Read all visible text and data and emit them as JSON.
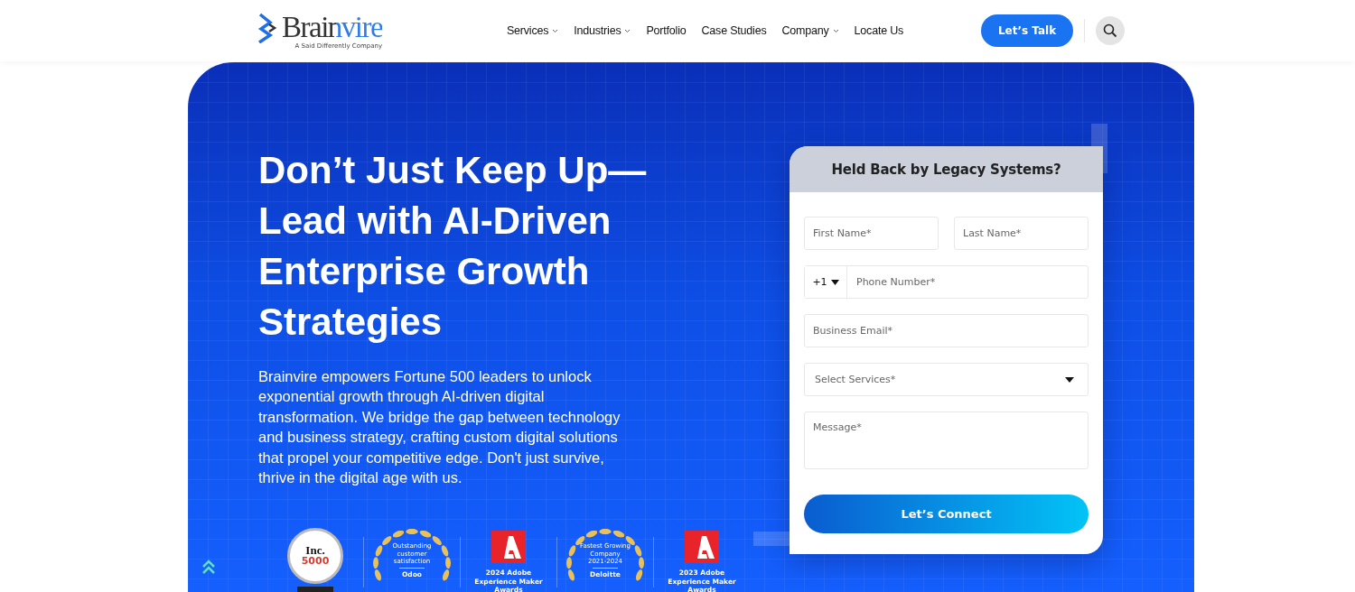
{
  "header": {
    "logo": {
      "name": "Brainvire",
      "tagline": "A Said Differently Company"
    },
    "nav": [
      {
        "label": "Services",
        "dropdown": true
      },
      {
        "label": "Industries",
        "dropdown": true
      },
      {
        "label": "Portfolio",
        "dropdown": false
      },
      {
        "label": "Case Studies",
        "dropdown": false
      },
      {
        "label": "Company",
        "dropdown": true
      },
      {
        "label": "Locate Us",
        "dropdown": false
      }
    ],
    "cta": "Let’s Talk"
  },
  "hero": {
    "heading": "Don’t Just Keep Up—Lead with AI-Driven Enterprise Growth Strategies",
    "description": "Brainvire empowers Fortune 500 leaders to unlock exponential growth through AI-driven digital transformation. We bridge the gap between technology and business strategy, crafting custom digital solutions that propel your competitive edge. Don't just survive, thrive in the digital age with us.",
    "awards": [
      {
        "kind": "trophy",
        "lines": [
          "Inc.",
          "5000"
        ]
      },
      {
        "kind": "laurel",
        "lines": [
          "Outstanding customer satisfaction"
        ],
        "issuer": "Odoo"
      },
      {
        "kind": "adobe",
        "lines": [
          "2024 Adobe Experience Maker Awards"
        ]
      },
      {
        "kind": "laurel",
        "lines": [
          "Fastest Growing Company",
          "2021-2024"
        ],
        "issuer": "Deloitte"
      },
      {
        "kind": "adobe",
        "lines": [
          "2023 Adobe Experience Maker Awards"
        ]
      }
    ]
  },
  "form": {
    "title": "Held Back by Legacy Systems?",
    "rows": [
      [
        {
          "kind": "text",
          "placeholder": "First Name*"
        },
        {
          "kind": "text",
          "placeholder": "Last Name*"
        }
      ],
      [
        {
          "kind": "phone",
          "code": "+1",
          "placeholder": "Phone Number*"
        }
      ],
      [
        {
          "kind": "text",
          "placeholder": "Business Email*"
        }
      ],
      [
        {
          "kind": "select",
          "placeholder": "Select Services*"
        }
      ],
      [
        {
          "kind": "textarea",
          "placeholder": "Message*"
        }
      ]
    ],
    "submit": "Let’s Connect"
  }
}
